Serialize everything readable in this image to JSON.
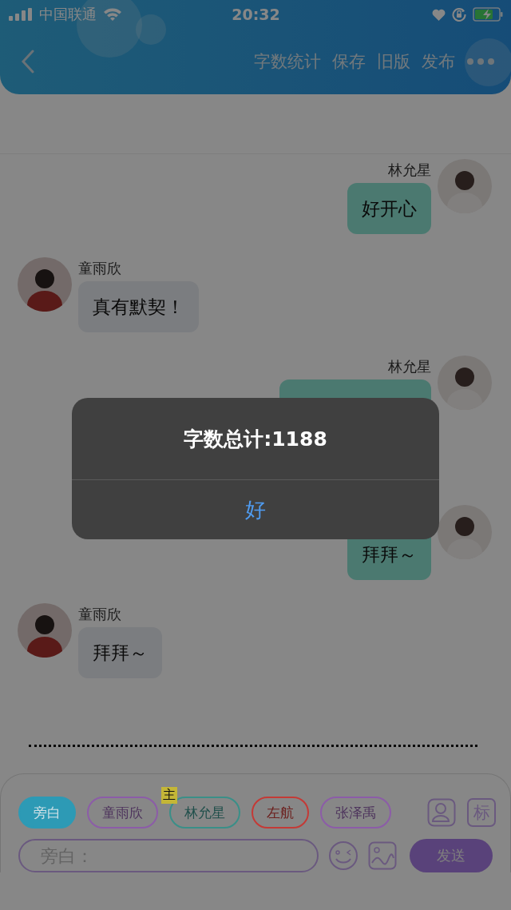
{
  "status_bar": {
    "carrier": "中国联通",
    "time": "20:32"
  },
  "nav": {
    "actions": [
      "字数统计",
      "保存",
      "旧版",
      "发布"
    ]
  },
  "messages": [
    {
      "kind": "sent",
      "name": "林允星",
      "text": "好开心"
    },
    {
      "kind": "received",
      "name": "童雨欣",
      "text": "真有默契！"
    },
    {
      "kind": "sent",
      "name": "林允星"
    },
    {
      "kind": "sent",
      "text": "拜拜～"
    },
    {
      "kind": "received",
      "name": "童雨欣",
      "text": "拜拜～"
    }
  ],
  "roles": [
    {
      "label": "旁白",
      "selected": true,
      "color": "#2d9ab5"
    },
    {
      "label": "童雨欣",
      "selected": false,
      "color": "#8c5ca8"
    },
    {
      "label": "林允星",
      "selected": false,
      "color": "#3a8f88",
      "badge": "主"
    },
    {
      "label": "左航",
      "selected": false,
      "color": "#c43a36"
    },
    {
      "label": "张泽禹",
      "selected": false,
      "color": "#8c5ca8"
    }
  ],
  "side_buttons": [
    "标"
  ],
  "input": {
    "placeholder": "旁白："
  },
  "send_button": "发送",
  "alert": {
    "title": "字数总计:1188",
    "button": "好"
  }
}
